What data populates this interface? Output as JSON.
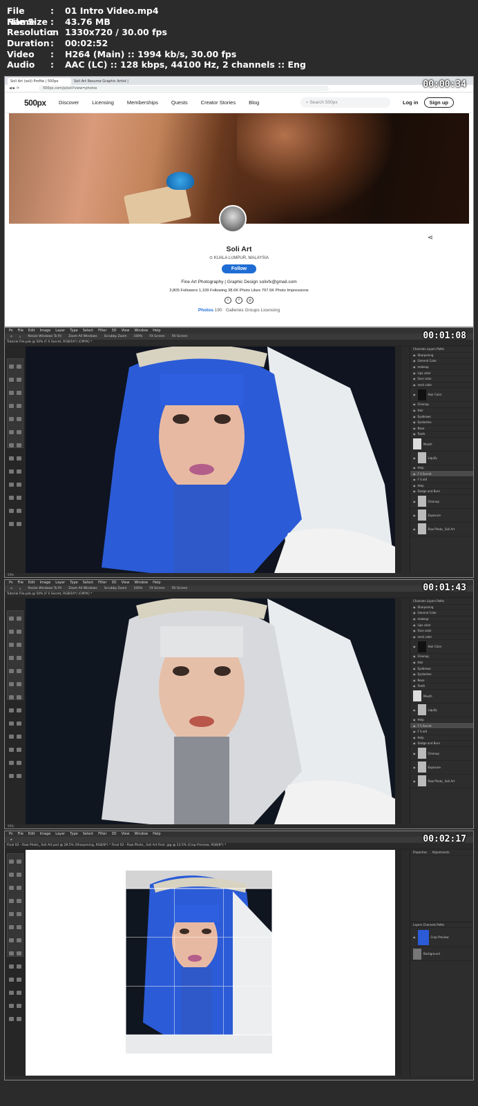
{
  "info": {
    "rows": [
      {
        "key": "File Name",
        "value": "01 Intro Video.mp4"
      },
      {
        "key": "File Size",
        "value": "43.76 MB"
      },
      {
        "key": "Resolution",
        "value": "1330x720 / 30.00 fps"
      },
      {
        "key": "Duration",
        "value": "00:02:52"
      },
      {
        "key": "Video",
        "value": "H264 (Main) :: 1994 kb/s, 30.00 fps"
      },
      {
        "key": "Audio",
        "value": "AAC (LC) :: 128 kbps, 44100 Hz, 2 channels :: Eng"
      }
    ]
  },
  "frames": {
    "f1_time": "00:00:34",
    "f2_time": "00:01:08",
    "f3_time": "00:01:43",
    "f4_time": "00:02:17"
  },
  "browser": {
    "tab1": "Soli Art (soli) Profile | 500px",
    "tab2": "Soli Art Resume Graphic Artist |",
    "url": "500px.com/p/soli?view=photos",
    "logo": "500px",
    "nav": [
      "Discover",
      "Licensing",
      "Memberships",
      "Quests",
      "Creator Stories",
      "Blog"
    ],
    "search_placeholder": "Search 500px",
    "login": "Log in",
    "signup": "Sign up",
    "name": "Soli Art",
    "location": "KUALA LUMPUR, MALAYSIA",
    "follow": "Follow",
    "desc": "Fine Art Photography | Graphic Design solivfx@gmail.com",
    "stats": "3,805 Followers   1,109 Following   38.6K Photo Likes   797.5K Photo Impressions",
    "tabs_photos": "Photos",
    "tabs_count": "190",
    "tabs_rest": "Galleries   Groups   Licensing"
  },
  "ps": {
    "menu": [
      "File",
      "Edit",
      "Image",
      "Layer",
      "Type",
      "Select",
      "Filter",
      "3D",
      "View",
      "Window",
      "Help"
    ],
    "doc1": "Tutorial File.psb @ 50% (F S Secret, RGB/16*) (CMYK) *",
    "doc3": "Tutorial File.psb @ 50% (F S Secret, RGB/16*) (CMYK) *",
    "doc4": "Final 02 - Raw Photo_ Soli Art.psd @ 28.5% (Sharpening, RGB/8*) *     Final 02 - Raw Photo_ Soli Art final .jpg @ 23.5% (Crop Preview, RGB/8*) *",
    "opts": [
      "Resize Windows To Fit",
      "Zoom All Windows",
      "Scrubby Zoom",
      "100%",
      "Fit Screen",
      "Fill Screen"
    ],
    "layers": [
      "Sharpening",
      "General Color",
      "makeup",
      "Lips color",
      "Face color",
      "neck color",
      "Hair Color",
      "Cleanup",
      "Hair",
      "Eyebrows",
      "Eyelashes",
      "Nose",
      "Teeth",
      "Mouth",
      "Liquify",
      "Help",
      "F S Secret",
      "F S old",
      "Help",
      "Dodge and Burn",
      "Cleanup",
      "Exposure",
      "Raw Photo_ Soli Art"
    ],
    "crop_layers": [
      "Crop Preview",
      "Background"
    ],
    "properties": "Properties",
    "adjustments": "Adjustments",
    "status": "50%"
  }
}
